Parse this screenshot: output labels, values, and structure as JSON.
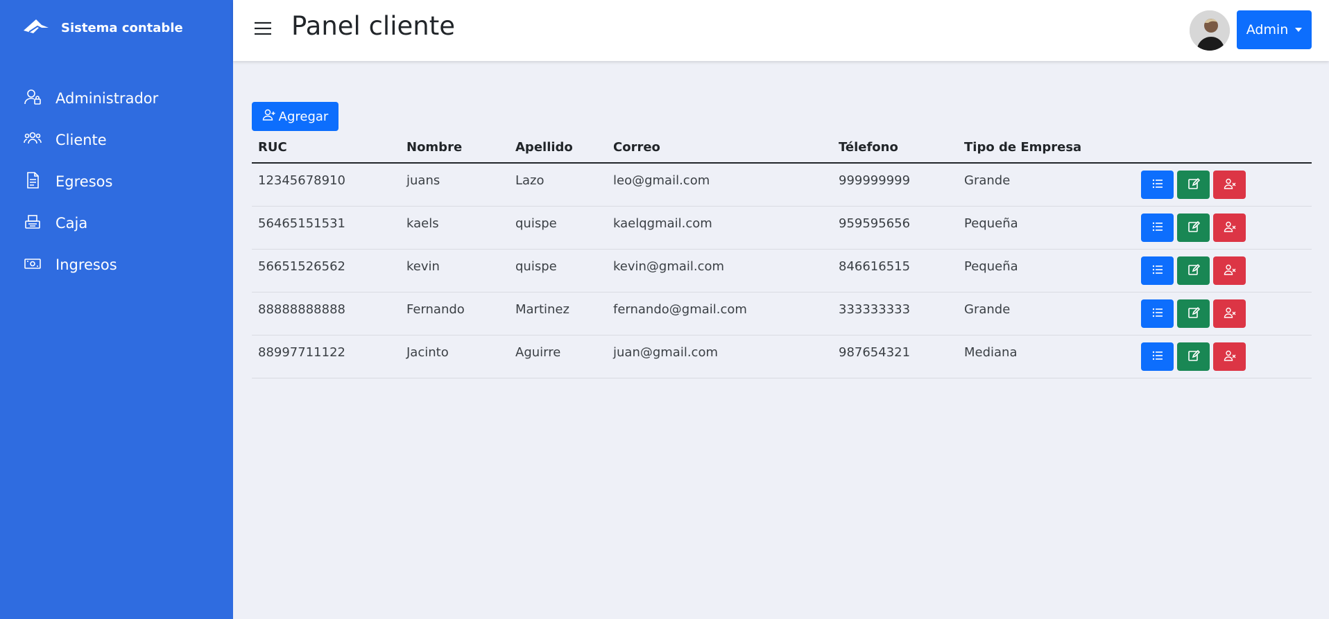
{
  "sidebar": {
    "brand": "Sistema contable",
    "items": [
      {
        "label": "Administrador",
        "icon": "admin-icon"
      },
      {
        "label": "Cliente",
        "icon": "people-icon"
      },
      {
        "label": "Egresos",
        "icon": "document-icon"
      },
      {
        "label": "Caja",
        "icon": "cash-register-icon"
      },
      {
        "label": "Ingresos",
        "icon": "cash-icon"
      }
    ]
  },
  "header": {
    "title": "Panel cliente",
    "user_label": "Admin"
  },
  "toolbar": {
    "add_label": "Agregar"
  },
  "table": {
    "columns": [
      "RUC",
      "Nombre",
      "Apellido",
      "Correo",
      "Télefono",
      "Tipo de Empresa"
    ],
    "rows": [
      [
        "12345678910",
        "juans",
        "Lazo",
        "leo@gmail.com",
        "999999999",
        "Grande"
      ],
      [
        "56465151531",
        "kaels",
        "quispe",
        "kaelqgmail.com",
        "959595656",
        "Pequeña"
      ],
      [
        "56651526562",
        "kevin",
        "quispe",
        "kevin@gmail.com",
        "846616515",
        "Pequeña"
      ],
      [
        "88888888888",
        "Fernando",
        "Martinez",
        "fernando@gmail.com",
        "333333333",
        "Grande"
      ],
      [
        "88997711122",
        "Jacinto",
        "Aguirre",
        "juan@gmail.com",
        "987654321",
        "Mediana"
      ]
    ]
  },
  "colors": {
    "sidebar": "#2f6ce0",
    "primary": "#0d6efd",
    "success": "#198754",
    "danger": "#dc3545",
    "background": "#eef0f7"
  }
}
